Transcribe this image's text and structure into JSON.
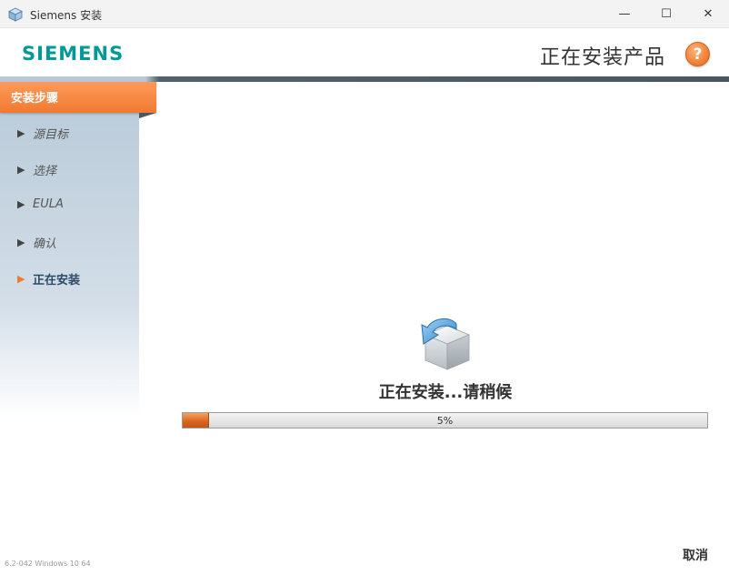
{
  "window": {
    "title": "Siemens 安装",
    "minimize_glyph": "—",
    "maximize_glyph": "☐",
    "close_glyph": "✕"
  },
  "header": {
    "logo": "SIEMENS",
    "title": "正在安装产品",
    "help_label": "?"
  },
  "sidebar": {
    "heading": "安装步骤",
    "steps": [
      {
        "label": "源目标",
        "arrow": "▶",
        "active": false
      },
      {
        "label": "选择",
        "arrow": "▶",
        "active": false
      },
      {
        "label": "EULA",
        "arrow": "▶",
        "active": false
      },
      {
        "label": "确认",
        "arrow": "▶",
        "active": false
      },
      {
        "label": "正在安装",
        "arrow": "▶",
        "active": true
      }
    ],
    "version": "6.2-042  Windows 10 64"
  },
  "main": {
    "status": "正在安装...请稍候",
    "progress": {
      "value": 0.05,
      "label": "5%"
    },
    "cancel_label": "取消"
  },
  "colors": {
    "accent": "#f07a32",
    "brand": "#009999",
    "active_step": "#2c4a66"
  },
  "icons": [
    "app-icon",
    "help-icon",
    "install-box-icon",
    "step-arrow-icon"
  ]
}
